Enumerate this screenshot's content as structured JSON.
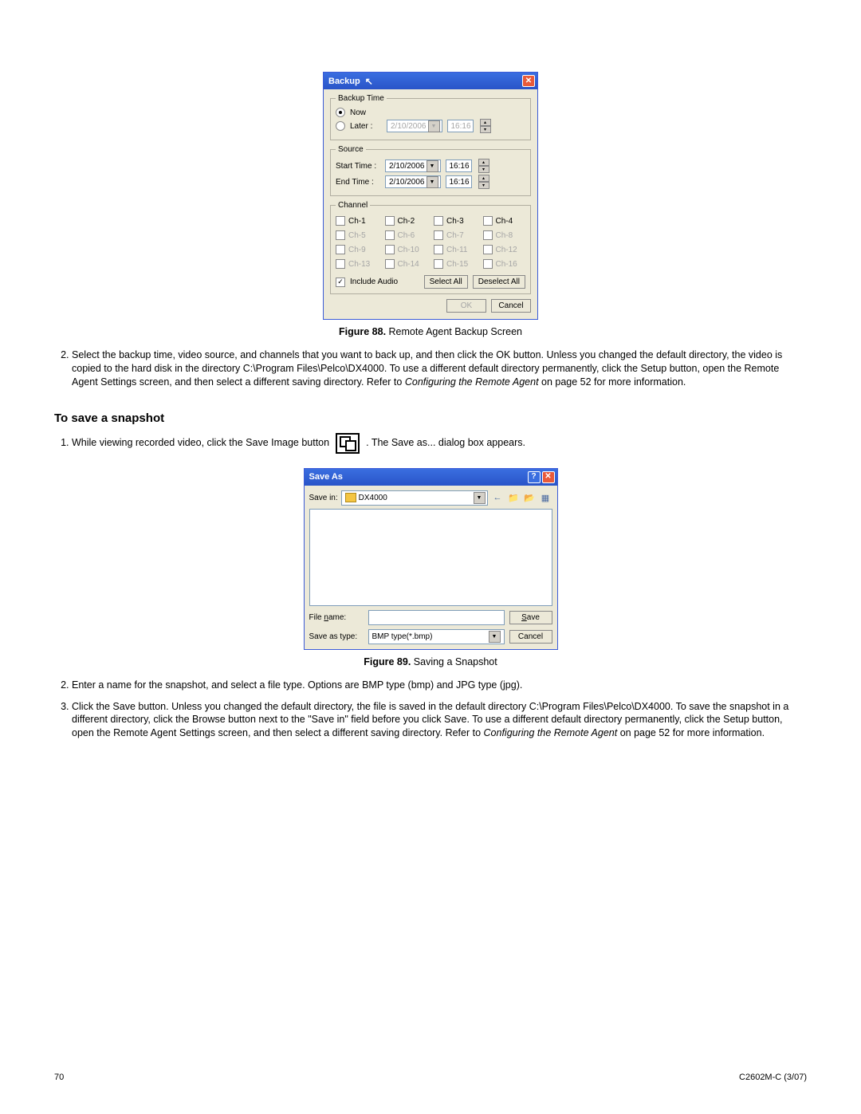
{
  "backup_dialog": {
    "title": "Backup",
    "groups": {
      "backup_time": {
        "legend": "Backup Time",
        "now": "Now",
        "later": "Later :",
        "later_date": "2/10/2006",
        "later_time": "16:16"
      },
      "source": {
        "legend": "Source",
        "start_label": "Start Time :",
        "end_label": "End Time :",
        "start_date": "2/10/2006",
        "start_time": "16:16",
        "end_date": "2/10/2006",
        "end_time": "16:16"
      },
      "channel": {
        "legend": "Channel",
        "labels": [
          "Ch-1",
          "Ch-2",
          "Ch-3",
          "Ch-4",
          "Ch-5",
          "Ch-6",
          "Ch-7",
          "Ch-8",
          "Ch-9",
          "Ch-10",
          "Ch-11",
          "Ch-12",
          "Ch-13",
          "Ch-14",
          "Ch-15",
          "Ch-16"
        ],
        "include_audio": "Include Audio",
        "select_all": "Select All",
        "deselect_all": "Deselect All"
      }
    },
    "ok": "OK",
    "cancel": "Cancel"
  },
  "figure88": {
    "label": "Figure 88.",
    "caption": "Remote Agent Backup Screen"
  },
  "step2_para": "Select the backup time, video source, and channels that you want to back up, and then click the OK button. Unless you changed the default directory, the video is copied to the hard disk in the directory C:\\Program Files\\Pelco\\DX4000. To use a different default directory permanently, click the Setup button, open the Remote Agent Settings screen, and then select a different saving directory. Refer to ",
  "step2_italic": "Configuring the Remote Agent",
  "step2_tail": " on page 52 for more information.",
  "snapshot_heading": "To save a snapshot",
  "snapshot_step1_a": "While viewing recorded video, click the Save Image button ",
  "snapshot_step1_b": " . The Save as... dialog box appears.",
  "saveas_dialog": {
    "title": "Save As",
    "save_in_label": "Save in:",
    "folder": "DX4000",
    "back_icon": "←",
    "up_icon": "📁",
    "new_icon": "📂",
    "view_icon": "▦",
    "file_name_label": "File name:",
    "file_name_value": "",
    "save_as_type_label": "Save as type:",
    "save_as_type_value": "BMP type(*.bmp)",
    "save": "Save",
    "cancel": "Cancel"
  },
  "figure89": {
    "label": "Figure 89.",
    "caption": "Saving a Snapshot"
  },
  "snapshot_step2": "Enter a name for the snapshot, and select a file type. Options are BMP type (bmp) and JPG type (jpg).",
  "snapshot_step3_a": "Click the Save button. Unless you changed the default directory, the file is saved in the default directory C:\\Program Files\\Pelco\\DX4000. To save the snapshot in a different directory, click the Browse button next to the \"Save in\" field before you click Save. To use a different default directory permanently, click the Setup button, open the Remote Agent Settings screen, and then select a different saving directory. Refer to ",
  "snapshot_step3_italic": "Configuring the Remote Agent",
  "snapshot_step3_b": " on page 52 for more information.",
  "footer": {
    "page": "70",
    "doc": "C2602M-C (3/07)"
  },
  "cursor": "↖"
}
